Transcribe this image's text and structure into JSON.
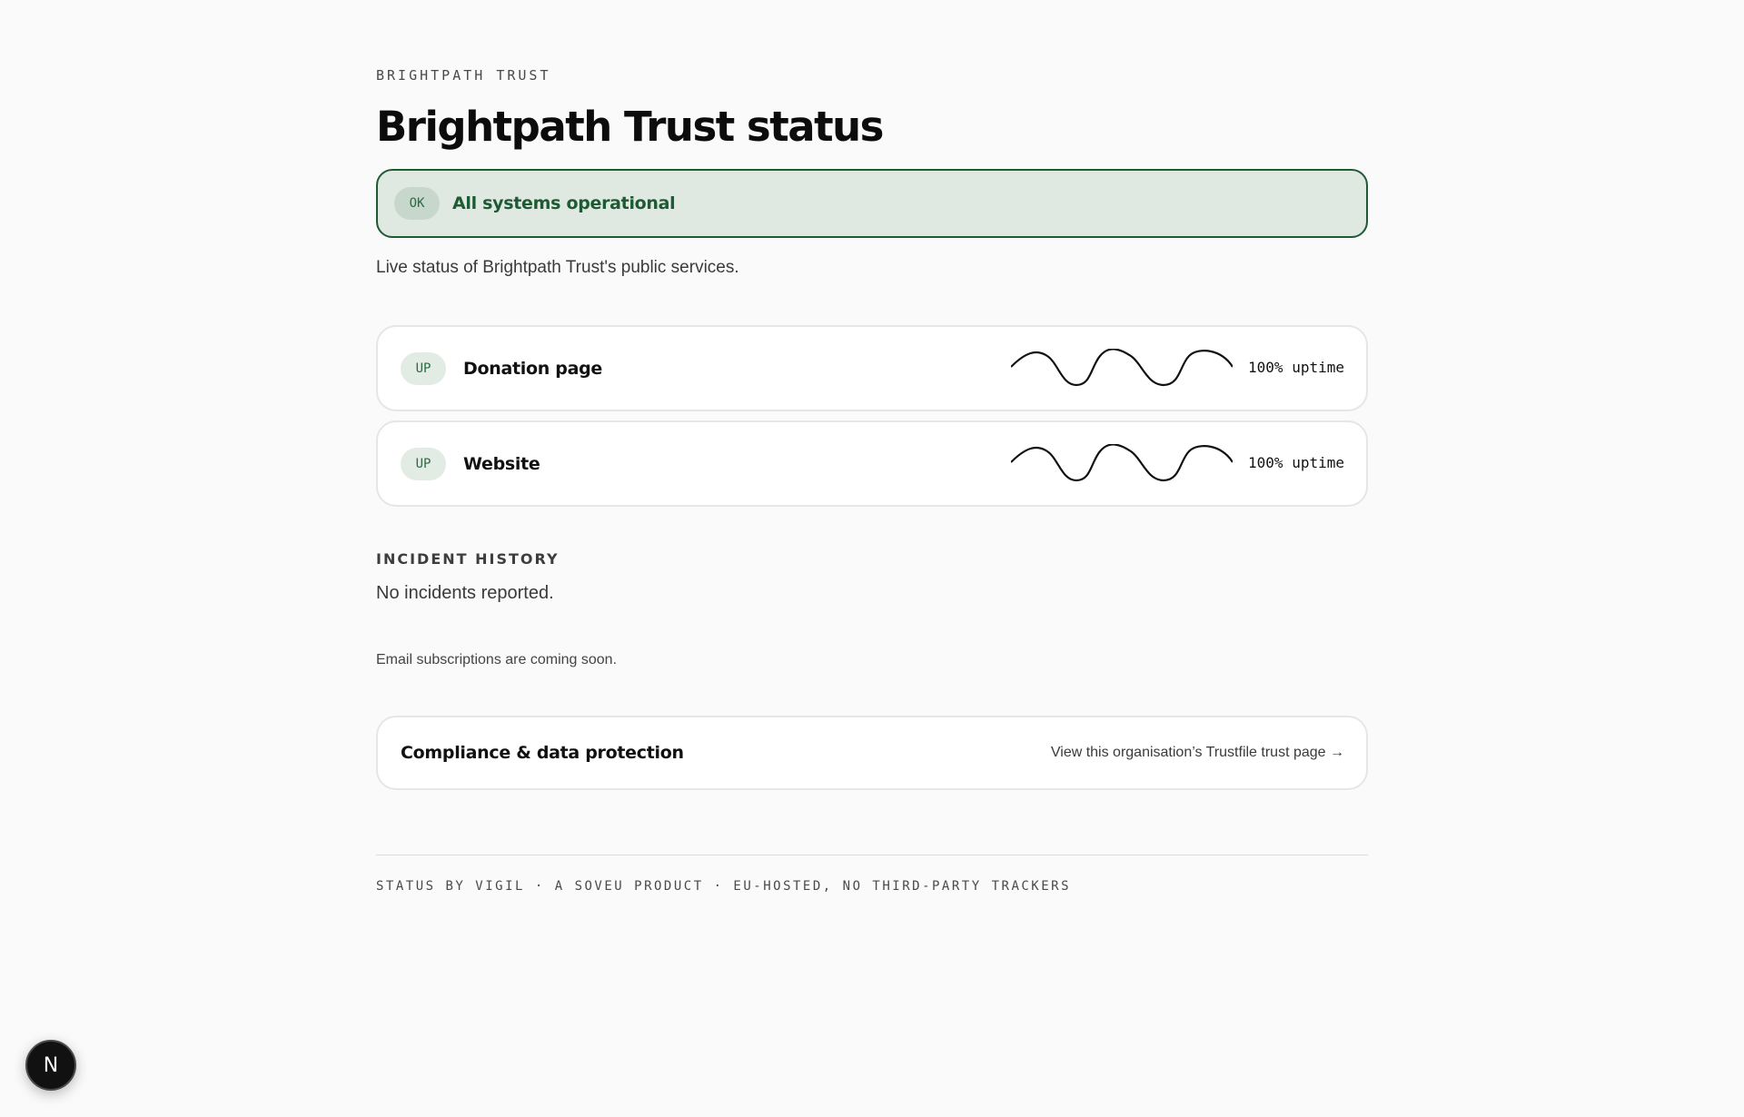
{
  "org": {
    "eyebrow": "BRIGHTPATH TRUST",
    "title": "Brightpath Trust status"
  },
  "banner": {
    "badge": "OK",
    "text": "All systems operational",
    "accent_color": "#1f5a35",
    "background_color": "#dfe8e1"
  },
  "subtitle": "Live status of Brightpath Trust's public services.",
  "services": [
    {
      "badge": "UP",
      "name": "Donation page",
      "uptime": "100% uptime"
    },
    {
      "badge": "UP",
      "name": "Website",
      "uptime": "100% uptime"
    }
  ],
  "incidents": {
    "heading": "INCIDENT HISTORY",
    "empty_text": "No incidents reported."
  },
  "email_note": "Email subscriptions are coming soon.",
  "compliance": {
    "title": "Compliance & data protection",
    "link_text": "View this organisation’s Trustfile trust page →"
  },
  "footer": {
    "text": "STATUS BY VIGIL · A SOVEU PRODUCT · EU-HOSTED, NO THIRD-PARTY TRACKERS"
  },
  "fab": {
    "label": "N",
    "icon": "next-logo-icon"
  }
}
